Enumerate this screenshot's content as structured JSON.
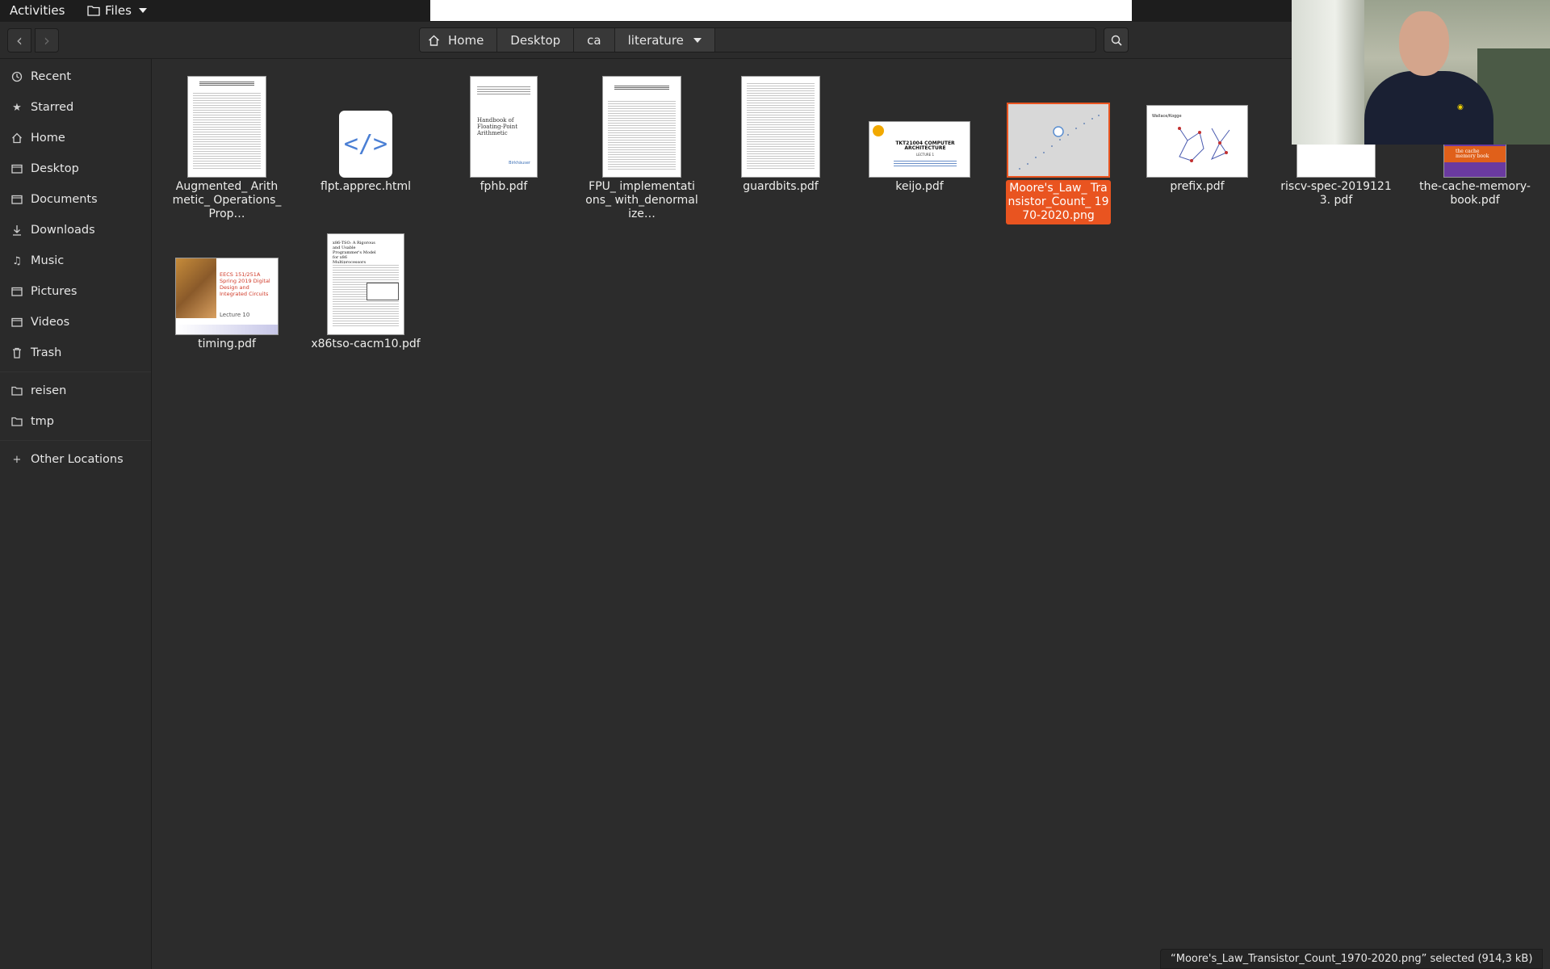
{
  "topbar": {
    "activities": "Activities",
    "app_menu": "Files"
  },
  "path": {
    "home": "Home",
    "desktop": "Desktop",
    "ca": "ca",
    "literature": "literature"
  },
  "sidebar": {
    "items": [
      {
        "label": "Recent",
        "icon": "clock-icon"
      },
      {
        "label": "Starred",
        "icon": "star-icon"
      },
      {
        "label": "Home",
        "icon": "home-icon"
      },
      {
        "label": "Desktop",
        "icon": "folder-icon"
      },
      {
        "label": "Documents",
        "icon": "folder-icon"
      },
      {
        "label": "Downloads",
        "icon": "download-icon"
      },
      {
        "label": "Music",
        "icon": "music-icon"
      },
      {
        "label": "Pictures",
        "icon": "folder-icon"
      },
      {
        "label": "Videos",
        "icon": "folder-icon"
      }
    ],
    "trash": "Trash",
    "bookmarks": [
      "reisen",
      "tmp"
    ],
    "other": "Other Locations"
  },
  "files": [
    {
      "name": "Augmented_ Arithmetic_ Operations_Prop…",
      "type": "pdf",
      "thumb_title": "Augmented Arithmetic Operations Proposed for IEEE-754 2018"
    },
    {
      "name": "flpt.apprec.html",
      "type": "html"
    },
    {
      "name": "fphb.pdf",
      "type": "pdf",
      "thumb_title": "Handbook of Floating-Point Arithmetic",
      "thumb_footer": "Birkhäuser"
    },
    {
      "name": "FPU_ implementations_ with_denormalize…",
      "type": "pdf",
      "thumb_title": "FPU Implementations with Denormalized Numbers"
    },
    {
      "name": "guardbits.pdf",
      "type": "pdf"
    },
    {
      "name": "keijo.pdf",
      "type": "pdf",
      "thumb_title": "TKT21004 COMPUTER ARCHITECTURE",
      "thumb_sub": "LECTURE 1"
    },
    {
      "name": "Moore's_Law_ Transistor_Count_ 1970-2020.png",
      "type": "png",
      "selected": true
    },
    {
      "name": "prefix.pdf",
      "type": "pdf",
      "thumb_title": "Wallace/Kogge"
    },
    {
      "name": "riscv-spec-20191213. pdf",
      "type": "pdf"
    },
    {
      "name": "the-cache-memory-book.pdf",
      "type": "pdf",
      "thumb_title": "the cache memory book"
    },
    {
      "name": "timing.pdf",
      "type": "pdf",
      "thumb_title": "EECS 151/251A Spring 2019 Digital Design and Integrated Circuits",
      "thumb_sub": "Lecture 10"
    },
    {
      "name": "x86tso-cacm10.pdf",
      "type": "pdf",
      "thumb_title": "x86-TSO: A Rigorous and Usable Programmer's Model for x86 Multiprocessors"
    }
  ],
  "status": "“Moore's_Law_Transistor_Count_1970-2020.png” selected  (914,3 kB)",
  "colors": {
    "accent": "#e95420",
    "sidebar_bg": "#2a2a2a",
    "content_bg": "#2c2c2c"
  }
}
